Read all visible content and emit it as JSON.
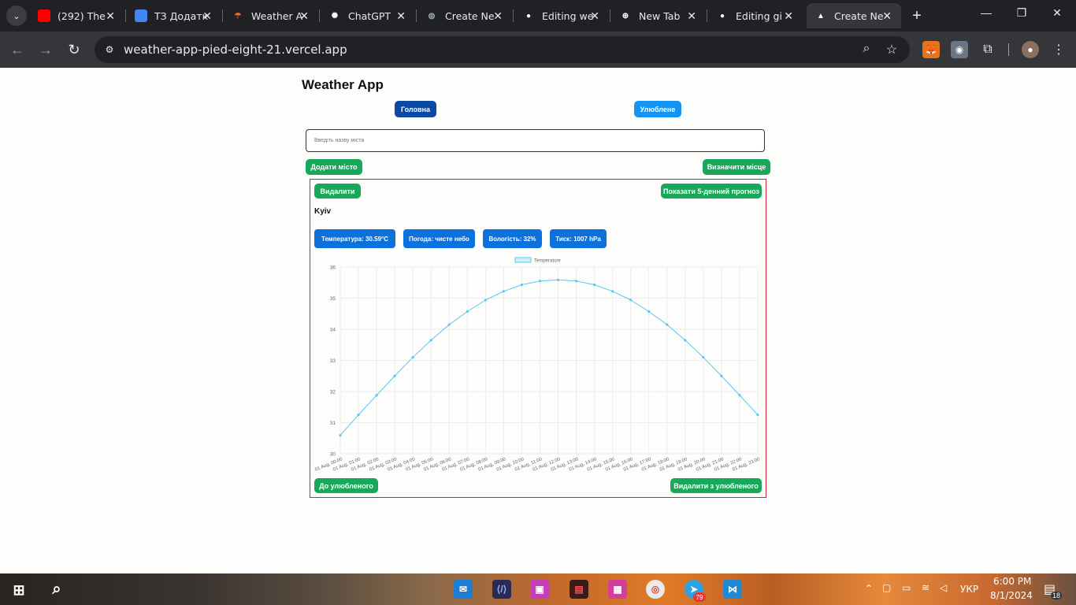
{
  "browser": {
    "tabs": [
      {
        "title": "(292) The",
        "favicon": "youtube-icon",
        "color": "#ff0000"
      },
      {
        "title": "ТЗ Додатк",
        "favicon": "docs-icon",
        "color": "#4285f4"
      },
      {
        "title": "Weather A",
        "favicon": "weather-icon",
        "color": "#e86a3a"
      },
      {
        "title": "ChatGPT",
        "favicon": "chatgpt-icon",
        "color": "#ffffff"
      },
      {
        "title": "Create Ne",
        "favicon": "globe-icon",
        "color": "#9aa0a6"
      },
      {
        "title": "Editing we",
        "favicon": "github-icon",
        "color": "#ffffff"
      },
      {
        "title": "New Tab",
        "favicon": "chrome-newtab-icon",
        "color": "#ffffff"
      },
      {
        "title": "Editing gi",
        "favicon": "github-icon",
        "color": "#ffffff"
      },
      {
        "title": "Create Ne",
        "favicon": "vercel-icon",
        "color": "#ffffff",
        "active": true
      }
    ],
    "url": "weather-app-pied-eight-21.vercel.app"
  },
  "app": {
    "title": "Weather App",
    "nav": {
      "home": "Головна",
      "favorites": "Улюблене"
    },
    "search_placeholder": "Введіть назву міста",
    "add_city": "Додати місто",
    "detect_location": "Визначити місце",
    "card": {
      "delete": "Видалити",
      "forecast": "Показати 5-денний прогноз",
      "city": "Kyiv",
      "stats": {
        "temperature": "Температура: 30.59°C",
        "weather": "Погода: чисте небо",
        "humidity": "Вологість: 32%",
        "pressure": "Тиск: 1007 hPa"
      },
      "to_favorites": "До улюбленого",
      "remove_favorites": "Видалити з улюбленого"
    }
  },
  "chart_data": {
    "type": "line",
    "legend": "Temperature",
    "color": "#5bc8ee",
    "ylim": [
      30,
      36
    ],
    "yticks": [
      "36",
      "35",
      "34",
      "33",
      "32",
      "31",
      "30"
    ],
    "x": [
      "01 Aug, 00:00",
      "01 Aug, 01:00",
      "01 Aug, 02:00",
      "01 Aug, 03:00",
      "01 Aug, 04:00",
      "01 Aug, 05:00",
      "01 Aug, 06:00",
      "01 Aug, 07:00",
      "01 Aug, 08:00",
      "01 Aug, 09:00",
      "01 Aug, 10:00",
      "01 Aug, 11:00",
      "01 Aug, 12:00",
      "01 Aug, 13:00",
      "01 Aug, 14:00",
      "01 Aug, 15:00",
      "01 Aug, 16:00",
      "01 Aug, 17:00",
      "01 Aug, 18:00",
      "01 Aug, 19:00",
      "01 Aug, 20:00",
      "01 Aug, 21:00",
      "01 Aug, 22:00",
      "01 Aug, 23:00"
    ],
    "values": [
      30.59,
      31.25,
      31.88,
      32.5,
      33.1,
      33.65,
      34.15,
      34.57,
      34.94,
      35.22,
      35.43,
      35.55,
      35.59,
      35.55,
      35.43,
      35.22,
      34.94,
      34.57,
      34.15,
      33.65,
      33.1,
      32.5,
      31.88,
      31.25
    ],
    "grid": true,
    "legend_position": "top-center"
  },
  "system": {
    "lang": "УКР",
    "time": "6:00 PM",
    "date": "8/1/2024",
    "notifications": "18",
    "telegram_badge": "79"
  }
}
